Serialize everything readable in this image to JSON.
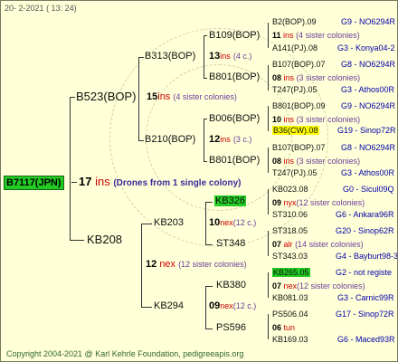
{
  "header": {
    "date": "20-  2-2021",
    "time": "( 13: 24)"
  },
  "footer": {
    "copyright": "Copyright 2004-2021 @ Karl Kehrle Foundation",
    "site": "pedigreeapis.org"
  },
  "root": {
    "id": "B7117(JPN)",
    "age": "17",
    "ins": "ins",
    "note": "(Drones from 1 single colony)"
  },
  "gen1": {
    "B523": {
      "id": "B523(BOP)",
      "age": "15",
      "ins": "ins",
      "col": "(4 sister colonies)"
    },
    "KB208": {
      "id": "KB208",
      "age": "12",
      "ins": "nex",
      "col": "(12 sister colonies)"
    }
  },
  "gen2": {
    "B313": {
      "id": "B313(BOP)",
      "age": "13",
      "ins": "ins",
      "col": "(4 c.)"
    },
    "B210": {
      "id": "B210(BOP)",
      "age": "12",
      "ins": "ins",
      "col": "(3 c.)"
    },
    "KB203": {
      "id": "KB203",
      "age": "10",
      "ins": "nex",
      "col": "(12 c.)"
    },
    "KB294": {
      "id": "KB294",
      "age": "09",
      "ins": "nex",
      "col": "(12 c.)"
    }
  },
  "gen3": {
    "B109": {
      "id": "B109(BOP)",
      "age": "11",
      "ins": "ins",
      "col": "(4 sister colonies)"
    },
    "B801a": {
      "id": "B801(BOP)",
      "age": "08",
      "ins": "ins",
      "col": "(3 sister colonies)"
    },
    "B006": {
      "id": "B006(BOP)",
      "age": "10",
      "ins": "ins",
      "col": "(3 sister colonies)"
    },
    "B801b": {
      "id": "B801(BOP)",
      "age": "08",
      "ins": "ins",
      "col": "(3 sister colonies)"
    },
    "KB326": {
      "id": "KB326",
      "age": "09",
      "ins": "nyx",
      "col": "(12 sister colonies)"
    },
    "ST348": {
      "id": "ST348",
      "age": "07",
      "ins": "alr",
      "col": "(14 sister colonies)"
    },
    "KB380": {
      "id": "KB380",
      "age": "07",
      "ins": "nex",
      "col": "(12 sister colonies)"
    },
    "PS596": {
      "id": "PS596",
      "age": "06",
      "ins": "tun",
      "col": ""
    }
  },
  "gen4": [
    {
      "id": "B2(BOP).09",
      "info": "G9 - NO6294R"
    },
    {
      "id": "A141(PJ).08",
      "info": "G3 - Konya04-2"
    },
    {
      "id": "B107(BOP).07",
      "info": "G8 - NO6294R"
    },
    {
      "id": "T247(PJ).05",
      "info": "G3 - Athos00R"
    },
    {
      "id": "B801(BOP).09",
      "info": "G9 - NO6294R"
    },
    {
      "id": "B36(CW).08",
      "info": "G19 - Sinop72R"
    },
    {
      "id": "B107(BOP).07",
      "info": "G8 - NO6294R"
    },
    {
      "id": "T247(PJ).05",
      "info": "G3 - Athos00R"
    },
    {
      "id": "KB023.08",
      "info": "G0 - Sicul09Q"
    },
    {
      "id": "ST310.06",
      "info": "G6 - Ankara96R"
    },
    {
      "id": "ST318.05",
      "info": "G20 - Sinop62R"
    },
    {
      "id": "ST343.03",
      "info": "G4 - Bayburt98-3"
    },
    {
      "id": "KB265.05",
      "info": "G2 - not registe"
    },
    {
      "id": "KB081.03",
      "info": "G3 - Carnic99R"
    },
    {
      "id": "PS506.04",
      "info": "G17 - Sinop72R"
    },
    {
      "id": "KB169.03",
      "info": "G6 - Maced93R"
    }
  ]
}
